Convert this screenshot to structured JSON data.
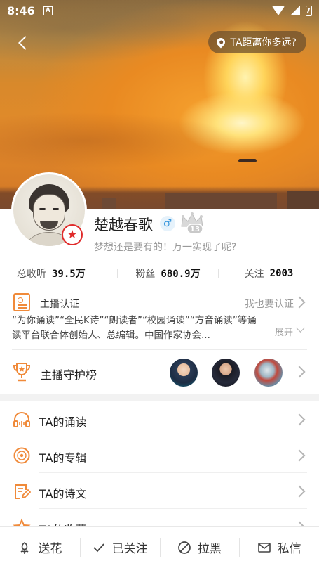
{
  "status_bar": {
    "time": "8:46",
    "notification": "A"
  },
  "header": {
    "distance_button": "TA距离你多远?"
  },
  "profile": {
    "name": "楚越春歌",
    "gender_symbol": "♂",
    "level": "13",
    "motto": "梦想还是要有的！万一实现了呢?",
    "stats": [
      {
        "label": "总收听",
        "value": "39.5万"
      },
      {
        "label": "粉丝",
        "value": "680.9万"
      },
      {
        "label": "关注",
        "value": "2003"
      }
    ]
  },
  "certification": {
    "label": "主播认证",
    "action": "我也要认证",
    "description": "“为你诵读”“全民K诗”“朗读者”“校园诵读”“方音诵读”等诵读平台联合体创始人、总编辑。中国作家协会...",
    "expand_label": "展开"
  },
  "guard": {
    "label": "主播守护榜"
  },
  "menu": [
    {
      "label": "TA的诵读",
      "icon": "headphones-icon"
    },
    {
      "label": "TA的专辑",
      "icon": "album-icon"
    },
    {
      "label": "TA的诗文",
      "icon": "poem-icon"
    },
    {
      "label": "TA的收藏",
      "icon": "favorite-icon"
    }
  ],
  "bottom_bar": [
    {
      "label": "送花",
      "icon": "flower-icon"
    },
    {
      "label": "已关注",
      "icon": "check-icon"
    },
    {
      "label": "拉黑",
      "icon": "block-icon"
    },
    {
      "label": "私信",
      "icon": "mail-icon"
    }
  ],
  "colors": {
    "accent": "#f08a3a",
    "vip_red": "#e02b2b",
    "gender_blue": "#3a98dd"
  }
}
